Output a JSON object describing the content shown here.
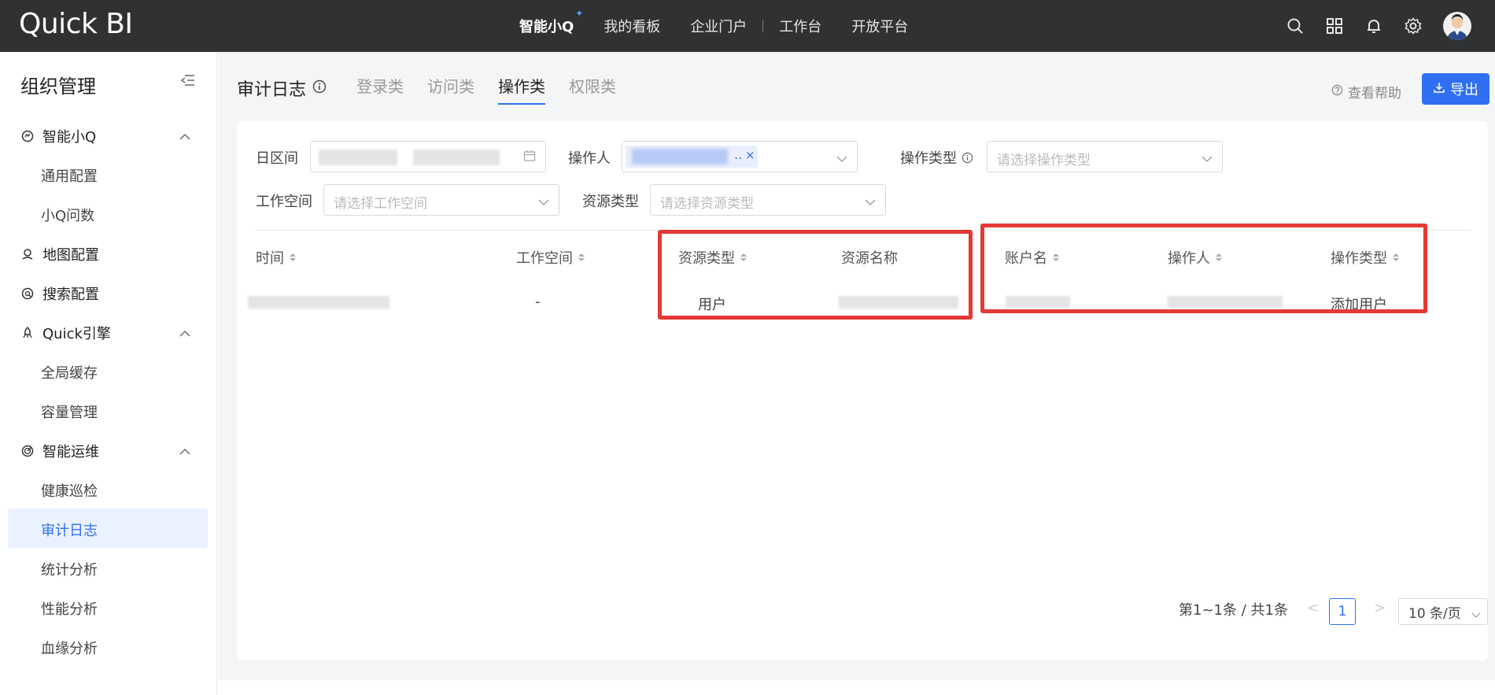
{
  "app": {
    "logo": "Quick BI"
  },
  "topnav": {
    "items": [
      "智能小Q",
      "我的看板",
      "企业门户",
      "工作台",
      "开放平台"
    ]
  },
  "sidebar": {
    "title": "组织管理",
    "groups": [
      {
        "label": "智能小Q",
        "icon": "chat-icon",
        "items": [
          "通用配置",
          "小Q问数"
        ]
      },
      {
        "label": "地图配置",
        "icon": "map-icon",
        "items": []
      },
      {
        "label": "搜索配置",
        "icon": "search-config-icon",
        "items": []
      },
      {
        "label": "Quick引擎",
        "icon": "engine-icon",
        "items": [
          "全局缓存",
          "容量管理"
        ]
      },
      {
        "label": "智能运维",
        "icon": "ops-icon",
        "items": [
          "健康巡检",
          "审计日志",
          "统计分析",
          "性能分析",
          "血缘分析"
        ]
      }
    ],
    "active_item": "审计日志"
  },
  "page": {
    "title": "审计日志",
    "tabs": [
      "登录类",
      "访问类",
      "操作类",
      "权限类"
    ],
    "active_tab": "操作类",
    "help": "查看帮助",
    "export": "导出"
  },
  "filters": {
    "date_label": "日区间",
    "operator_label": "操作人",
    "op_type_label": "操作类型",
    "op_type_placeholder": "请选择操作类型",
    "workspace_label": "工作空间",
    "workspace_placeholder": "请选择工作空间",
    "resource_type_label": "资源类型",
    "resource_type_placeholder": "请选择资源类型",
    "tag_ellipsis": "..",
    "tag_close": "×"
  },
  "table": {
    "columns": [
      "时间",
      "工作空间",
      "资源类型",
      "资源名称",
      "账户名",
      "操作人",
      "操作类型"
    ],
    "rows": [
      {
        "workspace": "-",
        "resource_type": "用户",
        "operation_type": "添加用户"
      }
    ]
  },
  "pagination": {
    "summary": "第1~1条 / 共1条",
    "current": "1",
    "page_size": "10 条/页",
    "prev": "<",
    "next": ">"
  },
  "colors": {
    "primary": "#2f6ff2",
    "highlight": "#e53935",
    "topbar": "#2f3133"
  }
}
